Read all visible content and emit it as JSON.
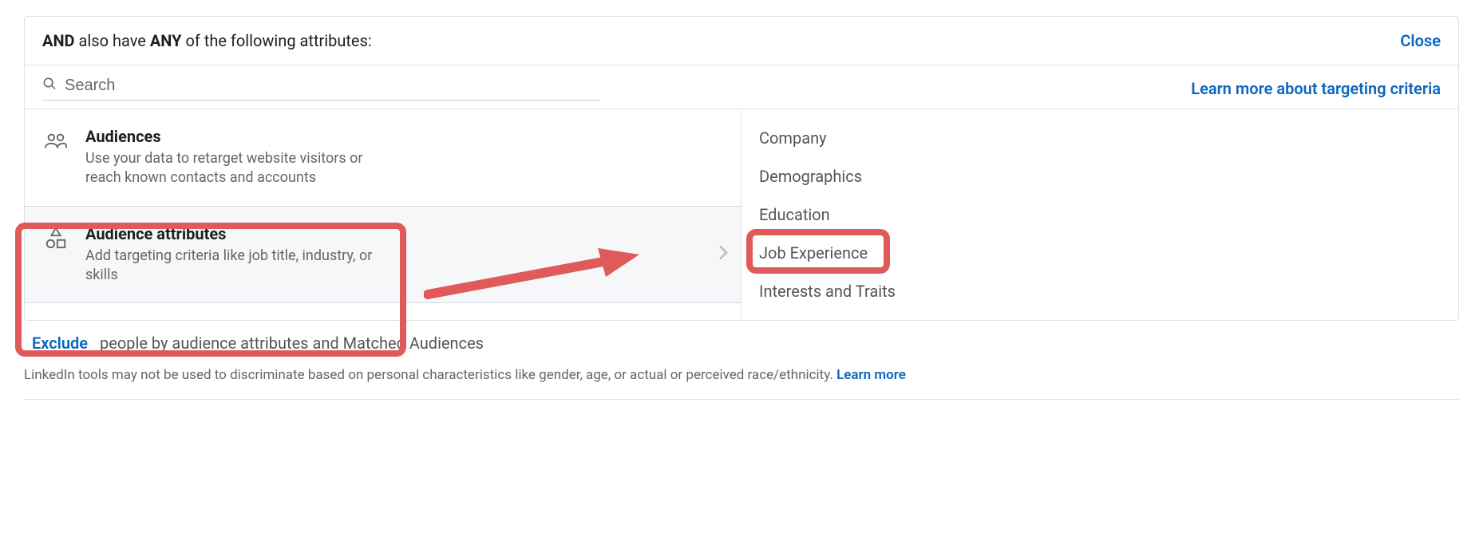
{
  "header": {
    "and": "AND",
    "also_have": " also have ",
    "any": "ANY",
    "rest": " of the following attributes:",
    "close": "Close"
  },
  "search": {
    "placeholder": "Search",
    "learn_more": "Learn more about targeting criteria"
  },
  "left": {
    "audiences": {
      "title": "Audiences",
      "desc": "Use your data to retarget website visitors or reach known contacts and accounts"
    },
    "attributes": {
      "title": "Audience attributes",
      "desc": "Add targeting criteria like job title, industry, or skills"
    }
  },
  "right": {
    "items": [
      "Company",
      "Demographics",
      "Education",
      "Job Experience",
      "Interests and Traits"
    ]
  },
  "exclude": {
    "link": "Exclude",
    "text": "people by audience attributes and Matched Audiences"
  },
  "disclaimer": {
    "text": "LinkedIn tools may not be used to discriminate based on personal characteristics like gender, age, or actual or perceived race/ethnicity. ",
    "learn_more": "Learn more"
  }
}
